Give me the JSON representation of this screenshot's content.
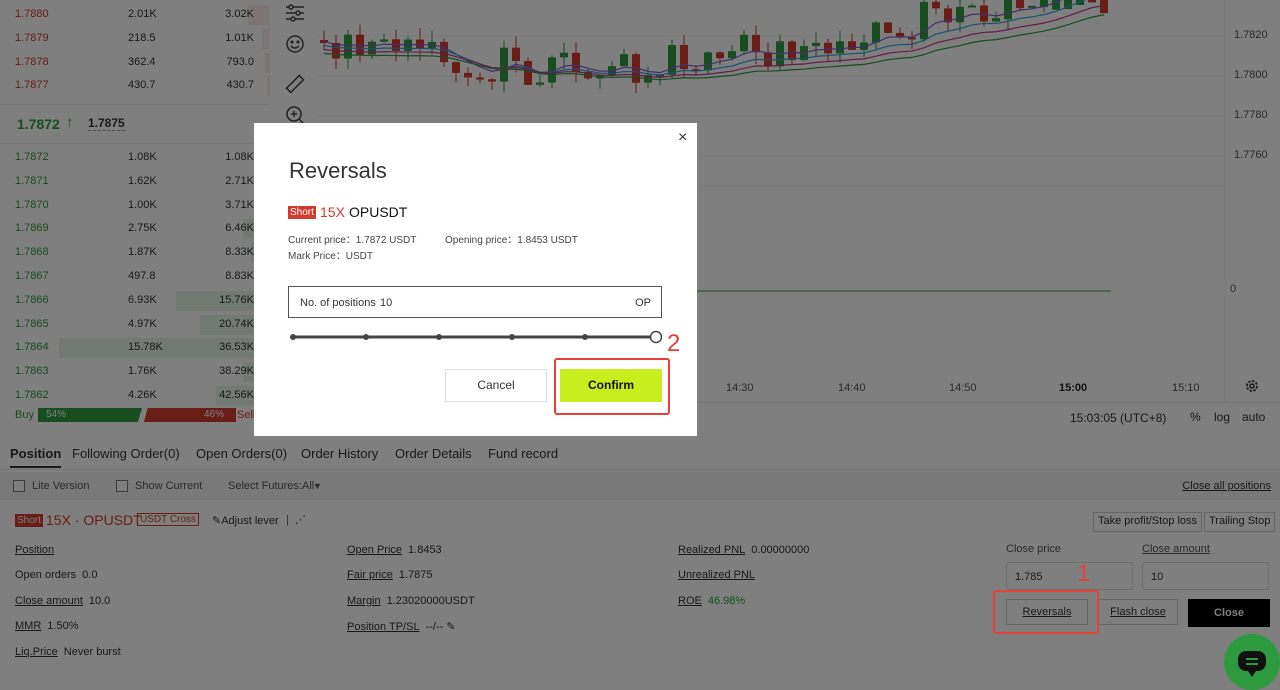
{
  "orderbook": {
    "asks": [
      {
        "price": "1.7880",
        "qty": "2.01K",
        "total": "3.02K",
        "depth": 0.08
      },
      {
        "price": "1.7879",
        "qty": "218.5",
        "total": "1.01K",
        "depth": 0.03
      },
      {
        "price": "1.7878",
        "qty": "362.4",
        "total": "793.0",
        "depth": 0.02
      },
      {
        "price": "1.7877",
        "qty": "430.7",
        "total": "430.7",
        "depth": 0.01
      }
    ],
    "mid_price": "1.7872",
    "mid_arrow": "↑",
    "mark_price": "1.7875",
    "bids": [
      {
        "price": "1.7872",
        "qty": "1.08K",
        "total": "1.08K",
        "depth": 0.03
      },
      {
        "price": "1.7871",
        "qty": "1.62K",
        "total": "2.71K",
        "depth": 0.05
      },
      {
        "price": "1.7870",
        "qty": "1.00K",
        "total": "3.71K",
        "depth": 0.04
      },
      {
        "price": "1.7869",
        "qty": "2.75K",
        "total": "6.46K",
        "depth": 0.1
      },
      {
        "price": "1.7868",
        "qty": "1.87K",
        "total": "8.33K",
        "depth": 0.07
      },
      {
        "price": "1.7867",
        "qty": "497.8",
        "total": "8.83K",
        "depth": 0.03
      },
      {
        "price": "1.7866",
        "qty": "6.93K",
        "total": "15.76K",
        "depth": 0.35
      },
      {
        "price": "1.7865",
        "qty": "4.97K",
        "total": "20.74K",
        "depth": 0.26
      },
      {
        "price": "1.7864",
        "qty": "15.78K",
        "total": "36.53K",
        "depth": 0.78
      },
      {
        "price": "1.7863",
        "qty": "1.76K",
        "total": "38.29K",
        "depth": 0.1
      },
      {
        "price": "1.7862",
        "qty": "4.26K",
        "total": "42.56K",
        "depth": 0.2
      }
    ],
    "buy_label": "Buy",
    "buy_pct": "54%",
    "sell_pct": "46%",
    "sell_label": "Sell"
  },
  "chart": {
    "y_ticks": [
      "1.7820",
      "1.7800",
      "1.7780",
      "1.7760",
      "0"
    ],
    "x_ticks": [
      "14:30",
      "14:40",
      "14:50",
      "15:00",
      "15:10"
    ],
    "clock": "15:03:05 (UTC+8)",
    "opt_pct": "%",
    "opt_log": "log",
    "opt_auto": "auto",
    "colors": {
      "up": "#2e9a3f",
      "down": "#d23a2e"
    }
  },
  "tabs": [
    "Position",
    "Following Order(0)",
    "Open Orders(0)",
    "Order History",
    "Order Details",
    "Fund record"
  ],
  "filters": {
    "lite": "Lite Version",
    "show_current": "Show Current",
    "select_futures": "Select Futures:All",
    "close_all": "Close all positions"
  },
  "position": {
    "side": "Short",
    "title": "15X · OPUSDT",
    "cross": "USDT Cross",
    "adjust_lever": "Adjust lever",
    "labels": {
      "position": "Position",
      "open_orders": "Open orders",
      "close_amount": "Close amount",
      "mmr": "MMR",
      "liq_price": "Liq.Price",
      "open_price": "Open Price",
      "fair_price": "Fair price",
      "margin": "Margin",
      "tpsl": "Position TP/SL",
      "realized": "Realized PNL",
      "unrealized": "Unrealized PNL",
      "roe": "ROE"
    },
    "values": {
      "open_orders": "0.0",
      "close_amount": "10.0",
      "mmr": "1.50%",
      "liq_price": "Never burst",
      "open_price": "1.8453",
      "fair_price": "1.7875",
      "margin": "1.23020000USDT",
      "tpsl": "--/--",
      "realized": "0.00000000",
      "roe": "46.98%"
    },
    "btn_tpsl": "Take profit/Stop loss",
    "btn_trailing": "Trailing Stop",
    "close_price_label": "Close price",
    "close_amount_label": "Close amount",
    "close_price_value": "1.785",
    "close_amount_value": "10",
    "btn_reversals": "Reversals",
    "btn_flash": "Flash close",
    "btn_close": "Close"
  },
  "annotations": {
    "one": "1",
    "two": "2"
  },
  "modal": {
    "close_glyph": "×",
    "title": "Reversals",
    "side": "Short",
    "leverage": "15X",
    "symbol": "OPUSDT",
    "current_price": "Current price：1.7872 USDT",
    "opening_price": "Opening price：1.8453 USDT",
    "mark_price": "Mark Price：USDT",
    "field_label": "No. of positions",
    "field_value": "10",
    "field_unit": "OP",
    "slider_fraction": 1.0,
    "cancel": "Cancel",
    "confirm": "Confirm"
  }
}
